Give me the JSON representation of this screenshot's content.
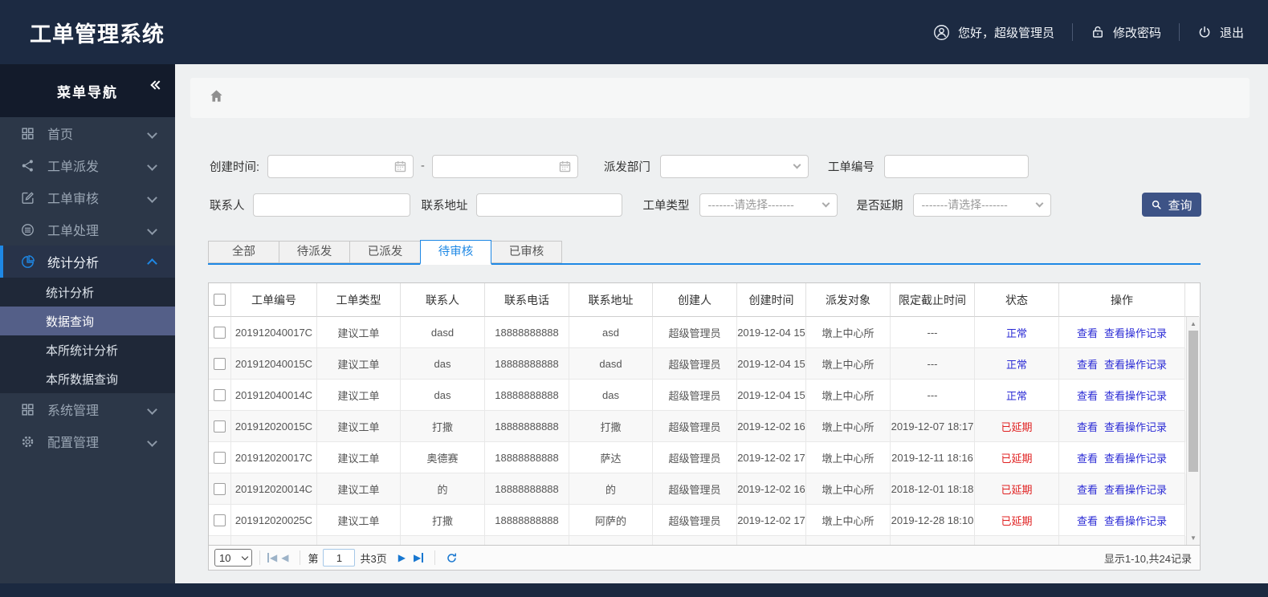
{
  "app": {
    "title": "工单管理系统"
  },
  "header": {
    "greeting": "您好，超级管理员",
    "change_password": "修改密码",
    "logout": "退出"
  },
  "sidebar": {
    "title": "菜单导航",
    "items": [
      {
        "label": "首页"
      },
      {
        "label": "工单派发"
      },
      {
        "label": "工单审核"
      },
      {
        "label": "工单处理"
      },
      {
        "label": "统计分析"
      },
      {
        "label": "系统管理"
      },
      {
        "label": "配置管理"
      }
    ],
    "submenu": [
      {
        "label": "统计分析"
      },
      {
        "label": "数据查询"
      },
      {
        "label": "本所统计分析"
      },
      {
        "label": "本所数据查询"
      }
    ]
  },
  "filters": {
    "create_time_label": "创建时间:",
    "separator": "-",
    "dispatch_dept_label": "派发部门",
    "order_no_label": "工单编号",
    "contact_label": "联系人",
    "address_label": "联系地址",
    "order_type_label": "工单类型",
    "delay_label": "是否延期",
    "select_placeholder": "-------请选择-------",
    "search_button": "查询"
  },
  "tabs": [
    {
      "label": "全部"
    },
    {
      "label": "待派发"
    },
    {
      "label": "已派发"
    },
    {
      "label": "待审核"
    },
    {
      "label": "已审核"
    }
  ],
  "table": {
    "columns": [
      "工单编号",
      "工单类型",
      "联系人",
      "联系电话",
      "联系地址",
      "创建人",
      "创建时间",
      "派发对象",
      "限定截止时间",
      "状态",
      "操作"
    ],
    "actions": {
      "view": "查看",
      "view_log": "查看操作记录"
    },
    "rows": [
      {
        "order_no": "201912040017C",
        "type": "建议工单",
        "contact": "dasd",
        "phone": "18888888888",
        "address": "asd",
        "creator": "超级管理员",
        "created": "2019-12-04 15",
        "target": "墩上中心所",
        "deadline": "---",
        "status": "正常",
        "status_type": "normal"
      },
      {
        "order_no": "201912040015C",
        "type": "建议工单",
        "contact": "das",
        "phone": "18888888888",
        "address": "dasd",
        "creator": "超级管理员",
        "created": "2019-12-04 15",
        "target": "墩上中心所",
        "deadline": "---",
        "status": "正常",
        "status_type": "normal"
      },
      {
        "order_no": "201912040014C",
        "type": "建议工单",
        "contact": "das",
        "phone": "18888888888",
        "address": "das",
        "creator": "超级管理员",
        "created": "2019-12-04 15",
        "target": "墩上中心所",
        "deadline": "---",
        "status": "正常",
        "status_type": "normal"
      },
      {
        "order_no": "201912020015C",
        "type": "建议工单",
        "contact": "打撒",
        "phone": "18888888888",
        "address": "打撒",
        "creator": "超级管理员",
        "created": "2019-12-02 16",
        "target": "墩上中心所",
        "deadline": "2019-12-07 18:17",
        "status": "已延期",
        "status_type": "delayed"
      },
      {
        "order_no": "201912020017C",
        "type": "建议工单",
        "contact": "奥德赛",
        "phone": "18888888888",
        "address": "萨达",
        "creator": "超级管理员",
        "created": "2019-12-02 17",
        "target": "墩上中心所",
        "deadline": "2019-12-11 18:16",
        "status": "已延期",
        "status_type": "delayed"
      },
      {
        "order_no": "201912020014C",
        "type": "建议工单",
        "contact": "的",
        "phone": "18888888888",
        "address": "的",
        "creator": "超级管理员",
        "created": "2019-12-02 16",
        "target": "墩上中心所",
        "deadline": "2018-12-01 18:18",
        "status": "已延期",
        "status_type": "delayed"
      },
      {
        "order_no": "201912020025C",
        "type": "建议工单",
        "contact": "打撒",
        "phone": "18888888888",
        "address": "阿萨的",
        "creator": "超级管理员",
        "created": "2019-12-02 17",
        "target": "墩上中心所",
        "deadline": "2019-12-28 18:10",
        "status": "已延期",
        "status_type": "delayed"
      }
    ]
  },
  "pagination": {
    "page_size": "10",
    "page_label_prefix": "第",
    "current_page": "1",
    "total_pages_label": "共3页",
    "summary": "显示1-10,共24记录"
  },
  "colors": {
    "accent_blue": "#1e88e5",
    "link_blue": "#2b2bd5",
    "status_red": "#e01f1f",
    "button_navy": "#3d5386",
    "header_navy": "#1c2a42"
  }
}
